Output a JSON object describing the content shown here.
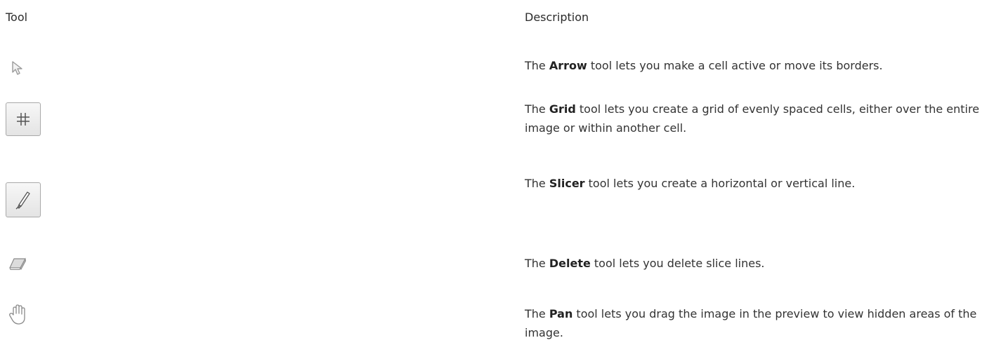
{
  "header": {
    "tool_label": "Tool",
    "description_label": "Description"
  },
  "tools": [
    {
      "icon": "arrow-icon",
      "prefix": "The ",
      "name": "Arrow",
      "suffix": " tool lets you make a cell active or move its borders."
    },
    {
      "icon": "grid-icon",
      "prefix": "The ",
      "name": "Grid",
      "suffix": " tool lets you create a grid of evenly spaced cells, either over the entire image or within another cell."
    },
    {
      "icon": "slicer-icon",
      "prefix": "The ",
      "name": "Slicer",
      "suffix": " tool lets you create a horizontal or vertical line."
    },
    {
      "icon": "delete-icon",
      "prefix": "The ",
      "name": "Delete",
      "suffix": " tool lets you delete slice lines."
    },
    {
      "icon": "pan-icon",
      "prefix": "The ",
      "name": "Pan",
      "suffix": " tool lets you drag the image in the preview to view hidden areas of the image."
    }
  ]
}
